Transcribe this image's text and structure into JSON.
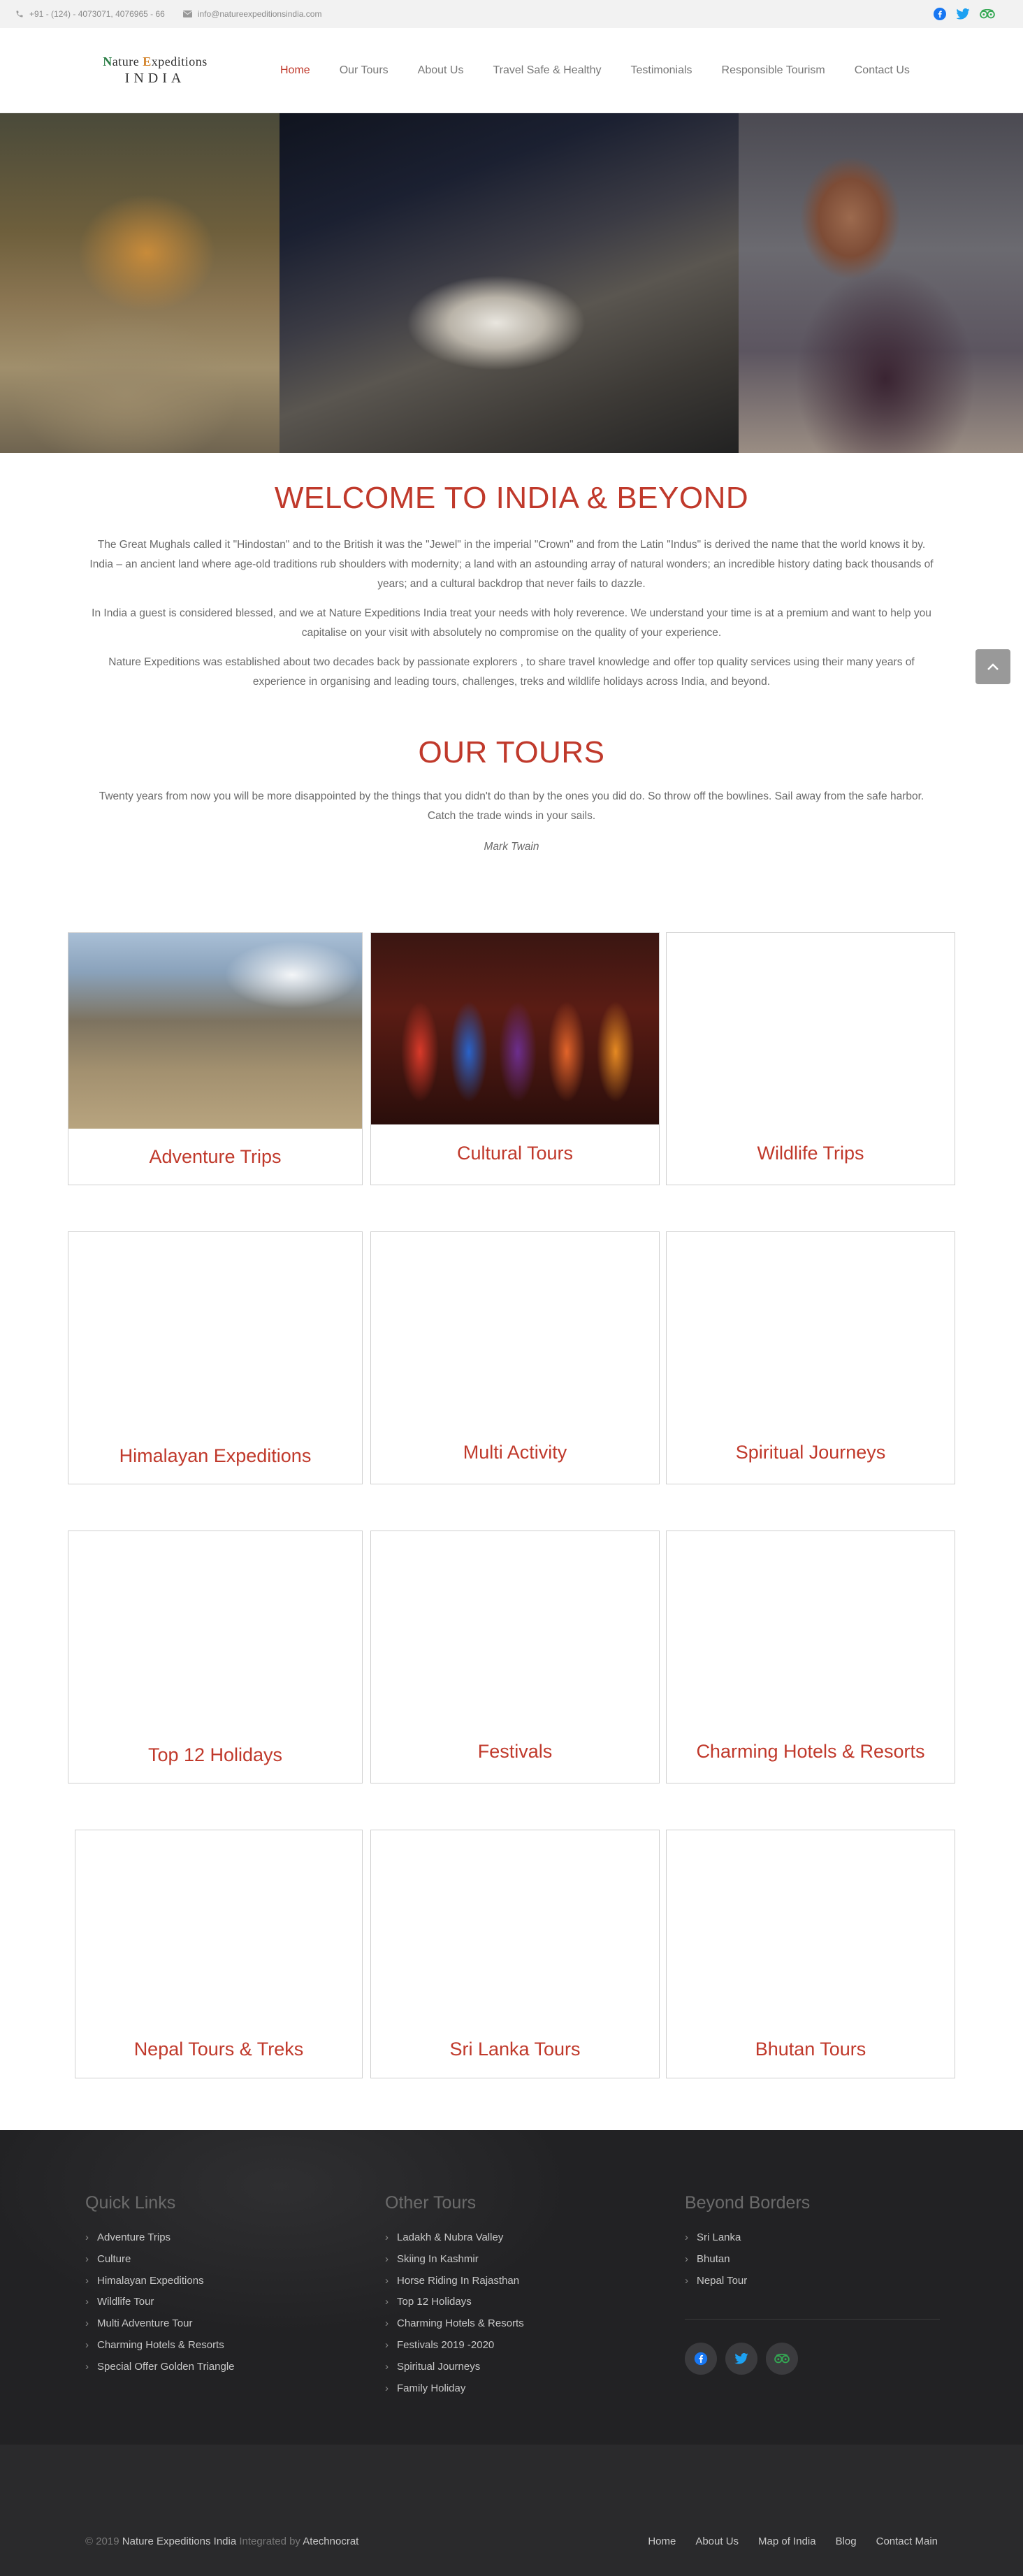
{
  "topbar": {
    "phone": "+91 - (124) - 4073071, 4076965 - 66",
    "email": "info@natureexpeditionsindia.com"
  },
  "logo": {
    "line1_a": "N",
    "line1_b": "ature ",
    "line1_c": "E",
    "line1_d": "xpeditions",
    "line2": "INDIA"
  },
  "nav": [
    "Home",
    "Our Tours",
    "About Us",
    "Travel Safe & Healthy",
    "Testimonials",
    "Responsible Tourism",
    "Contact Us"
  ],
  "welcome": {
    "title": "WELCOME TO INDIA & BEYOND",
    "p1": "The Great Mughals called it \"Hindostan\" and to the British it was the \"Jewel\" in the imperial \"Crown\" and from the Latin \"Indus\" is derived the name that the world knows it by. India – an ancient land where age-old traditions rub shoulders with modernity; a land with an astounding array of natural wonders; an incredible history dating back thousands of years; and a cultural backdrop that never fails to dazzle.",
    "p2": "In India a guest is considered blessed, and we at Nature Expeditions India treat your needs with holy reverence. We understand your time is at a premium and want to help you capitalise on your visit with absolutely no compromise on the quality of your experience.",
    "p3": "Nature Expeditions was established about two decades back by passionate explorers , to share travel knowledge and offer top quality services using their many years of experience in organising and leading tours, challenges, treks and wildlife holidays across India, and beyond."
  },
  "tours": {
    "title": "OUR TOURS",
    "quote": "Twenty years from now you will be more disappointed by the things that you didn't do than by the ones you did do. So throw off the bowlines. Sail away from the safe harbor. Catch the trade winds in your sails.",
    "author": "Mark Twain",
    "cards": [
      "Adventure Trips",
      "Cultural Tours",
      "Wildlife Trips",
      "Himalayan Expeditions",
      "Multi Activity",
      "Spiritual Journeys",
      "Top 12 Holidays",
      "Festivals",
      "Charming Hotels & Resorts",
      "Nepal Tours & Treks",
      "Sri Lanka Tours",
      "Bhutan Tours"
    ]
  },
  "footer": {
    "quick_links": {
      "title": "Quick Links",
      "items": [
        "Adventure Trips",
        "Culture",
        "Himalayan Expeditions",
        "Wildlife Tour",
        "Multi Adventure Tour",
        "Charming Hotels & Resorts",
        "Special Offer Golden Triangle"
      ]
    },
    "other_tours": {
      "title": "Other Tours",
      "items": [
        "Ladakh & Nubra Valley",
        "Skiing In Kashmir",
        "Horse Riding In Rajasthan",
        "Top 12 Holidays",
        "Charming Hotels & Resorts",
        "Festivals 2019 -2020",
        "Spiritual Journeys",
        "Family Holiday"
      ]
    },
    "beyond": {
      "title": "Beyond Borders",
      "items": [
        "Sri Lanka",
        "Bhutan",
        "Nepal Tour"
      ]
    },
    "copyright_prefix": "© 2019",
    "copyright_name": "Nature Expeditions India",
    "copyright_mid": "Integrated by",
    "copyright_by": "Atechnocrat",
    "bottom_links": [
      "Home",
      "About Us",
      "Map of India",
      "Blog",
      "Contact Main"
    ]
  },
  "colors": {
    "accent": "#c0392b",
    "facebook": "#1877f2",
    "twitter": "#1da1f2",
    "tripadvisor": "#34e0a1"
  },
  "icons": [
    "phone-icon",
    "mail-icon",
    "facebook-icon",
    "twitter-icon",
    "tripadvisor-icon",
    "chevron-up-icon"
  ]
}
